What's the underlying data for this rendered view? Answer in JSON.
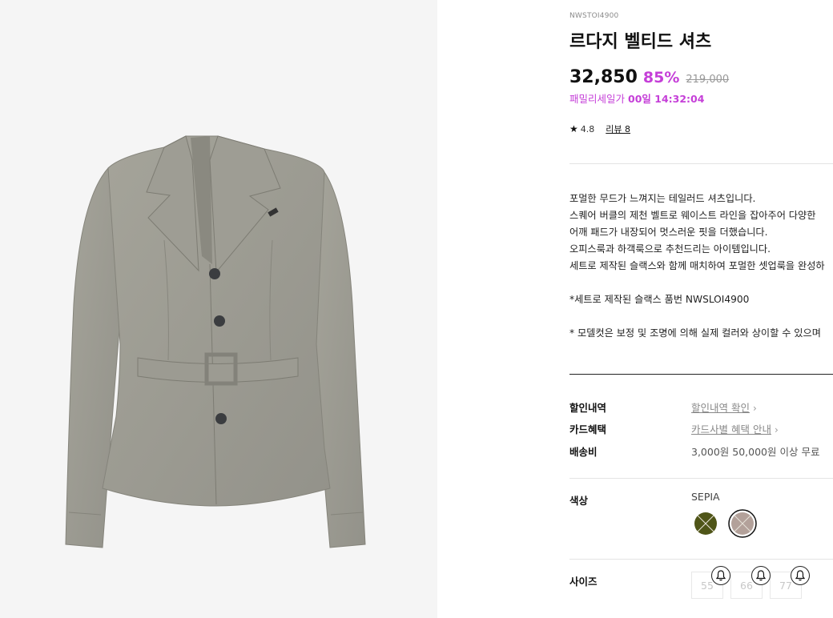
{
  "product": {
    "code": "NWSTOI4900",
    "title": "르다지 벨티드 셔츠",
    "image_alt": "jacket-product-photo"
  },
  "pricing": {
    "price": "32,850",
    "discount": "85%",
    "original": "219,000",
    "sale_label": "패밀리세일가",
    "timer": "00일 14:32:04"
  },
  "rating": {
    "score": "4.8",
    "review_link": "리뷰 8"
  },
  "description": {
    "lines": [
      "포멀한 무드가 느껴지는 테일러드 셔츠입니다.",
      "스퀘어 버클의 제천 벨트로 웨이스트 라인을 잡아주어 다양한",
      "어깨 패드가 내장되어 멋스러운 핏을 더했습니다.",
      "오피스룩과 하객룩으로 추천드리는 아이템입니다.",
      "세트로 제작된 슬랙스와 함께 매치하여 포멀한 셋업룩을 완성하",
      "*세트로 제작된 슬랙스 품번 NWSLOI4900",
      "* 모델컷은 보정 및 조명에 의해 실제 컬러와 상이할 수 있으며"
    ]
  },
  "details": {
    "discount_label": "할인내역",
    "discount_link": "할인내역 확인",
    "card_label": "카드혜택",
    "card_link": "카드사별 혜택 안내",
    "shipping_label": "배송비",
    "shipping_value": "3,000원 50,000원 이상 무료"
  },
  "options": {
    "color_label": "색상",
    "color_selected": "SEPIA",
    "swatches": [
      {
        "name": "olive",
        "color": "#4f5518",
        "soldout": true,
        "selected": false
      },
      {
        "name": "sepia",
        "color": "#b3a19a",
        "soldout": true,
        "selected": true
      }
    ],
    "size_label": "사이즈",
    "sizes": [
      "55",
      "66",
      "77"
    ]
  },
  "icons": {
    "star": "star-icon",
    "chevron": "chevron-right-icon",
    "bell": "bell-icon"
  }
}
